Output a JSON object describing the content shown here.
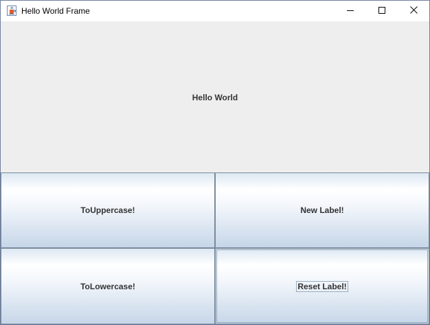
{
  "window": {
    "title": "Hello World Frame",
    "app_icon": "java-cup-icon"
  },
  "window_controls": {
    "minimize_icon": "minimize-icon",
    "maximize_icon": "maximize-icon",
    "close_icon": "close-icon"
  },
  "label_panel": {
    "text": "Hello World"
  },
  "buttons": {
    "to_uppercase": "ToUppercase!",
    "new_label": "New Label!",
    "to_lowercase": "ToLowercase!",
    "reset_label": "Reset Label!",
    "focused": "reset_label"
  },
  "colors": {
    "button_border": "#7a8a99",
    "button_gradient_top": "#dde8f3",
    "button_gradient_bottom": "#c6d6e8",
    "panel_background": "#eeeeee",
    "text": "#333333"
  }
}
